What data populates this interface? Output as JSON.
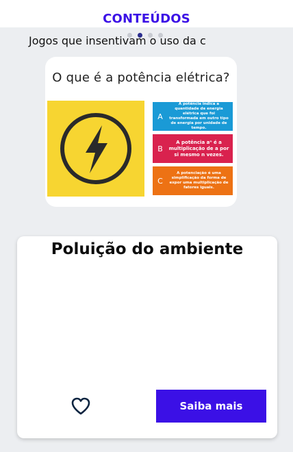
{
  "header": {
    "title": "CONTEÚDOS"
  },
  "carousel": {
    "caption": "Jogos que insentivam o uso da c",
    "dot_count": 4,
    "active_dot_index": 1,
    "slide": {
      "question": "O que é a potência elétrica?",
      "image_icon": "lightning-bolt-icon",
      "options": [
        {
          "letter": "A",
          "text": "A potência indica a quantidade de energia elétrica que foi transformada em outro tipo de energia por unidade de tempo.",
          "color": "#1a9ad6"
        },
        {
          "letter": "B",
          "text": "A potência aⁿ é a multiplicação de a por si mesmo n vezes.",
          "color": "#d9224e"
        },
        {
          "letter": "C",
          "text": "A potenciação é uma simplificação da forma de expor uma multiplicação de fatores iguais.",
          "color": "#ed7214"
        }
      ]
    }
  },
  "card": {
    "title": "Poluição do ambiente",
    "favorite_icon": "heart-outline-icon",
    "cta_label": "Saiba mais"
  },
  "colors": {
    "brand": "#3b10e6",
    "background": "#eceef1",
    "card": "#ffffff",
    "image_yellow": "#f7d531"
  }
}
